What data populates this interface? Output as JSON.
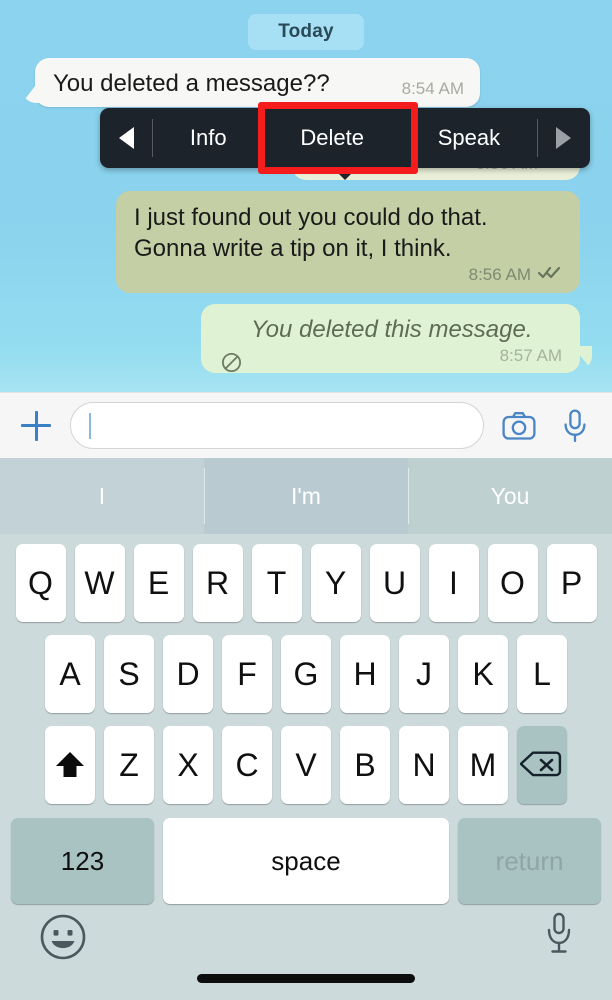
{
  "app": "whatsapp-chat-ios",
  "chat": {
    "day_divider": "Today",
    "messages": [
      {
        "id": "in-1",
        "direction": "incoming",
        "text": "You deleted a message??",
        "time": "8:54 AM",
        "status": ""
      },
      {
        "id": "out-hidden",
        "direction": "outgoing",
        "text": "",
        "time": "8:56 AM",
        "status": "read"
      },
      {
        "id": "out-1",
        "direction": "outgoing",
        "text": "I just found out you could do that.\nGonna write a tip on it, I think.",
        "time": "8:56 AM",
        "status": "read",
        "selected": true
      },
      {
        "id": "out-2",
        "direction": "outgoing",
        "text": "You deleted this message.",
        "time": "8:57 AM",
        "status": "",
        "deleted": true,
        "icon": "prohibition-icon"
      }
    ]
  },
  "context_menu": {
    "prev_label": "◀",
    "next_label": "▶",
    "items": [
      {
        "label": "Info",
        "highlighted": false
      },
      {
        "label": "Delete",
        "highlighted": true
      },
      {
        "label": "Speak",
        "highlighted": false
      }
    ],
    "highlight_color": "#f41c1c",
    "background": "#1c232b"
  },
  "input_bar": {
    "plus_icon": "plus-icon",
    "placeholder": "",
    "value": "",
    "camera_icon": "camera-icon",
    "mic_icon": "microphone-icon",
    "accent": "#3b7fc4"
  },
  "suggestions": {
    "items": [
      "I",
      "I'm",
      "You"
    ]
  },
  "keyboard": {
    "row1": [
      "Q",
      "W",
      "E",
      "R",
      "T",
      "Y",
      "U",
      "I",
      "O",
      "P"
    ],
    "row2": [
      "A",
      "S",
      "D",
      "F",
      "G",
      "H",
      "J",
      "K",
      "L"
    ],
    "row3": [
      "Z",
      "X",
      "C",
      "V",
      "B",
      "N",
      "M"
    ],
    "shift_icon": "shift-arrow-icon",
    "backspace_icon": "backspace-icon",
    "numbers_label": "123",
    "space_label": "space",
    "return_label": "return",
    "emoji_icon": "emoji-smiley-icon",
    "dictation_icon": "microphone-icon",
    "background": "#ccdadb",
    "key_background": "#ffffff",
    "fn_key_background": "#a9c3c2"
  }
}
